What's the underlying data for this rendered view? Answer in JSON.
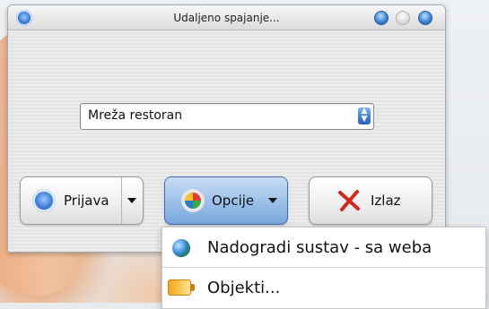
{
  "window": {
    "title": "Udaljeno spajanje..."
  },
  "icons": {
    "app": "remote-connect-icon",
    "window_controls": [
      "minimize-icon",
      "maximize-icon",
      "close-icon"
    ],
    "login": "remote-connect-icon",
    "options": "options-icon",
    "exit": "x-icon",
    "menu": [
      "globe-icon",
      "battery-icon"
    ]
  },
  "network_select": {
    "value": "Mreža restoran"
  },
  "buttons": {
    "login_label": "Prijava",
    "options_label": "Opcije",
    "exit_label": "Izlaz"
  },
  "options_menu": {
    "items": [
      {
        "label": "Nadogradi sustav - sa weba"
      },
      {
        "label": "Objekti..."
      }
    ]
  },
  "colors": {
    "accent": "#3c7fd6",
    "exit_red": "#d3281f"
  }
}
